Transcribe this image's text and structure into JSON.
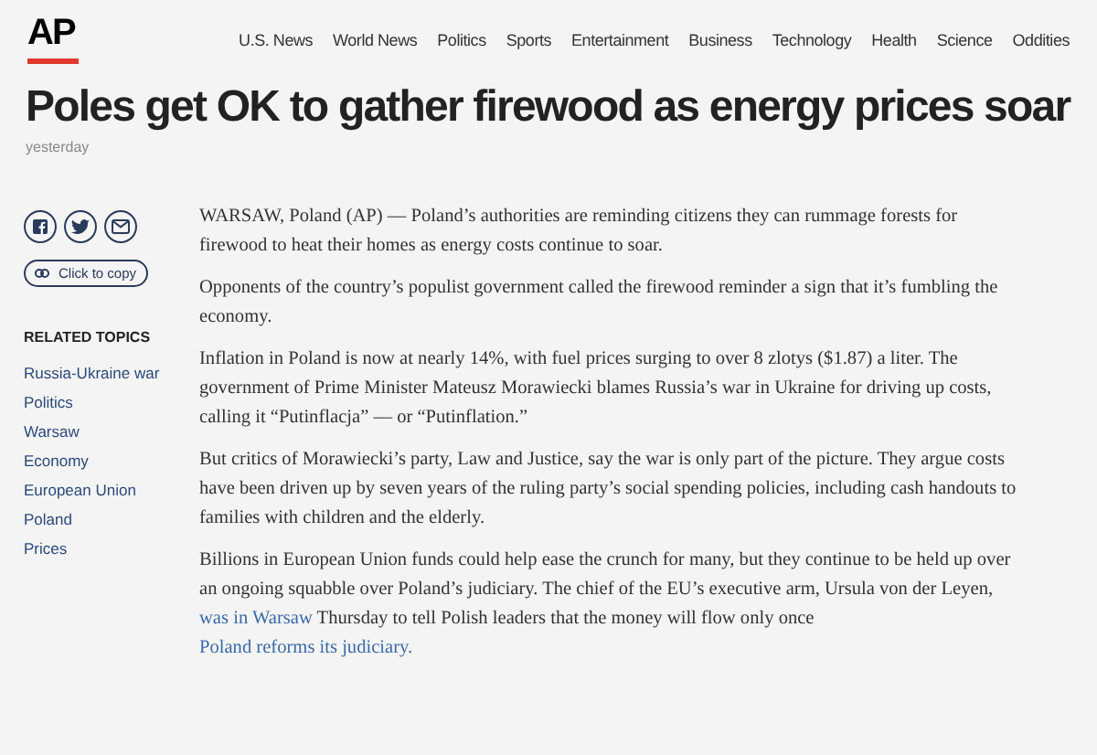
{
  "logo": "AP",
  "nav": [
    "U.S. News",
    "World News",
    "Politics",
    "Sports",
    "Entertainment",
    "Business",
    "Technology",
    "Health",
    "Science",
    "Oddities"
  ],
  "headline": "Poles get OK to gather firewood as energy prices soar",
  "timestamp": "yesterday",
  "share": {
    "buttons": [
      {
        "kind": "facebook"
      },
      {
        "kind": "twitter"
      },
      {
        "kind": "email"
      }
    ],
    "copy_label": "Click to copy"
  },
  "related_topics": {
    "title": "RELATED TOPICS",
    "items": [
      "Russia-Ukraine war",
      "Politics",
      "Warsaw",
      "Economy",
      "European Union",
      "Poland",
      "Prices"
    ]
  },
  "paragraphs": [
    [
      {
        "kind": "text",
        "text": "WARSAW, Poland (AP) — Poland’s authorities are reminding citizens they can rummage forests for firewood to heat their homes as energy costs continue to soar."
      }
    ],
    [
      {
        "kind": "text",
        "text": "Opponents of the country’s populist government called the firewood reminder a sign that it’s fumbling the economy."
      }
    ],
    [
      {
        "kind": "text",
        "text": "Inflation in Poland is now at nearly 14%, with fuel prices surging to over 8 zlotys ($1.87) a liter. The government of Prime Minister Mateusz Morawiecki blames Russia’s war in Ukraine for driving up costs, calling it “Putinflacja” — or “Putinflation.”"
      }
    ],
    [
      {
        "kind": "text",
        "text": "But critics of Morawiecki’s party, Law and Justice, say the war is only part of the picture. They argue costs have been driven up by seven years of the ruling party’s social spending policies, including cash handouts to families with children and the elderly."
      }
    ],
    [
      {
        "kind": "text",
        "text": "Billions in European Union funds could help ease the crunch for many, but they continue to be held up over an ongoing squabble over Poland’s judiciary. The chief of the EU’s executive arm, Ursula von der Leyen, "
      },
      {
        "kind": "link",
        "text": "was in Warsaw"
      },
      {
        "kind": "text",
        "text": " Thursday to tell Polish leaders that the money will flow only once "
      },
      {
        "kind": "link",
        "text": "Poland reforms its judiciary."
      }
    ]
  ]
}
